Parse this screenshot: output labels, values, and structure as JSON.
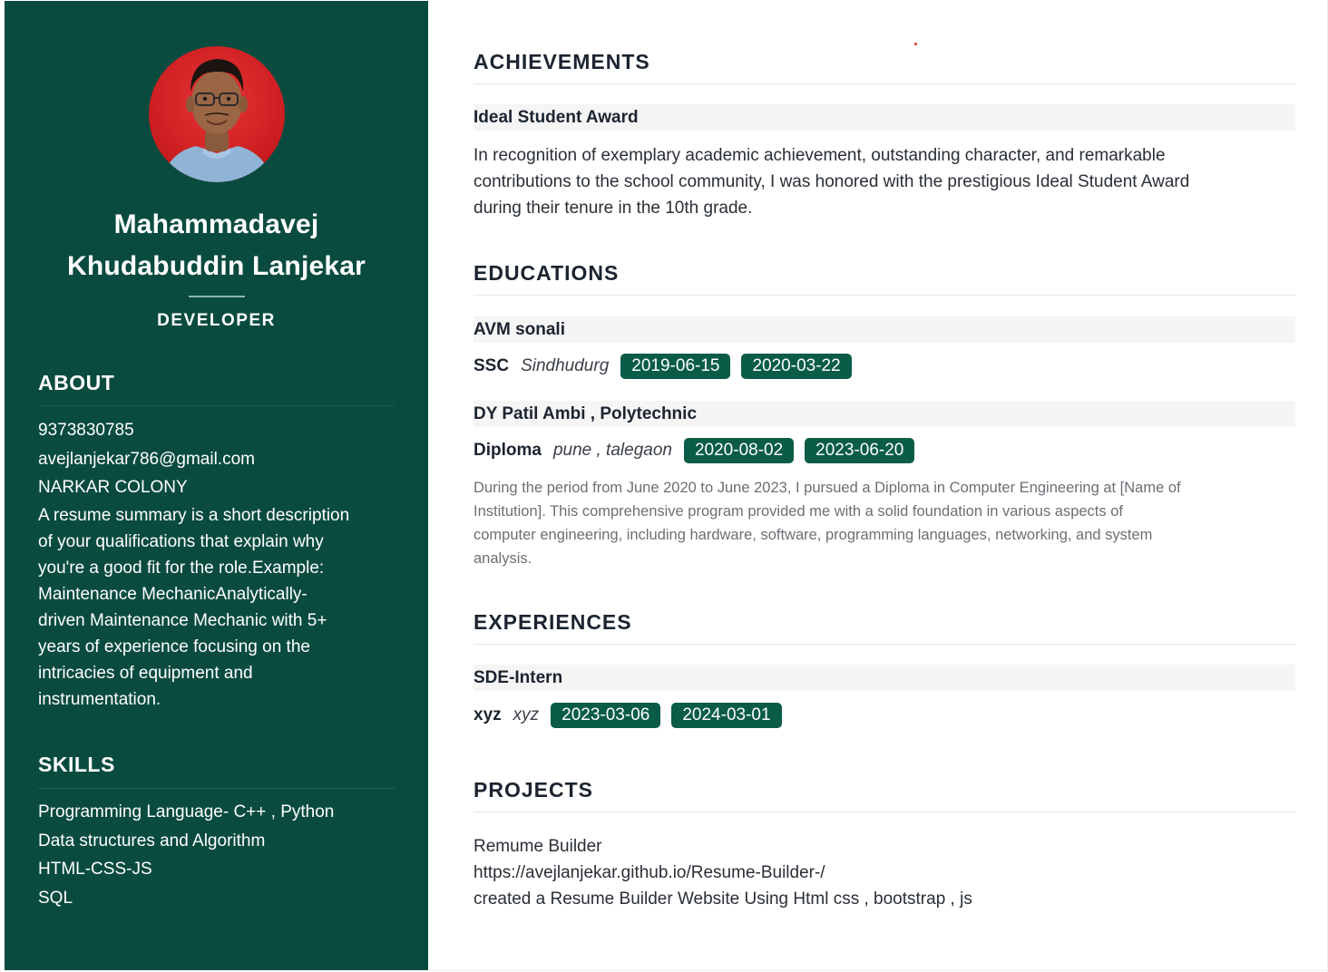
{
  "profile": {
    "name_line1": "Mahammadavej",
    "name_line2": "Khudabuddin Lanjekar",
    "role": "DEVELOPER",
    "avatar_icon": "person-photo"
  },
  "about": {
    "heading": "ABOUT",
    "phone": "9373830785",
    "email": "avejlanjekar786@gmail.com",
    "address": "NARKAR COLONY",
    "summary_lines": [
      "A resume summary is a short description",
      "of your qualifications that explain why",
      "you're a good fit for the role.Example:",
      "Maintenance MechanicAnalytically-",
      "driven Maintenance Mechanic with 5+",
      "years of experience focusing on the",
      "intricacies of equipment and",
      "instrumentation."
    ]
  },
  "skills": {
    "heading": "SKILLS",
    "items": [
      "Programming Language- C++ , Python",
      "Data structures and Algorithm",
      "HTML-CSS-JS",
      "SQL"
    ]
  },
  "achievements": {
    "heading": "ACHIEVEMENTS",
    "items": [
      {
        "title": "Ideal Student Award",
        "description_lines": [
          "In recognition of exemplary academic achievement, outstanding character, and remarkable",
          "contributions to the school community, I was honored with the prestigious Ideal Student Award",
          "during their tenure in the 10th grade."
        ]
      }
    ]
  },
  "educations": {
    "heading": "EDUCATIONS",
    "items": [
      {
        "school": "AVM sonali",
        "degree": "SSC",
        "location": "Sindhudurg",
        "start": "2019-06-15",
        "end": "2020-03-22"
      },
      {
        "school": "DY Patil Ambi , Polytechnic",
        "degree": "Diploma",
        "location": "pune , talegaon",
        "start": "2020-08-02",
        "end": "2023-06-20",
        "description_lines": [
          "During the period from June 2020 to June 2023, I pursued a Diploma in Computer Engineering at [Name of",
          "Institution]. This comprehensive program provided me with a solid foundation in various aspects of",
          "computer engineering, including hardware, software, programming languages, networking, and system",
          "analysis."
        ]
      }
    ]
  },
  "experiences": {
    "heading": "EXPERIENCES",
    "items": [
      {
        "title": "SDE-Intern",
        "company": "xyz",
        "location": "xyz",
        "start": "2023-03-06",
        "end": "2024-03-01"
      }
    ]
  },
  "projects": {
    "heading": "PROJECTS",
    "items": [
      {
        "name": "Remume Builder",
        "link": "https://avejlanjekar.github.io/Resume-Builder-/",
        "description": "created a Resume Builder Website Using Html css , bootstrap , js"
      }
    ]
  },
  "colors": {
    "sidebar": "#0a4b3f",
    "badge": "#0a5c47",
    "heading_text": "#1b2430"
  }
}
